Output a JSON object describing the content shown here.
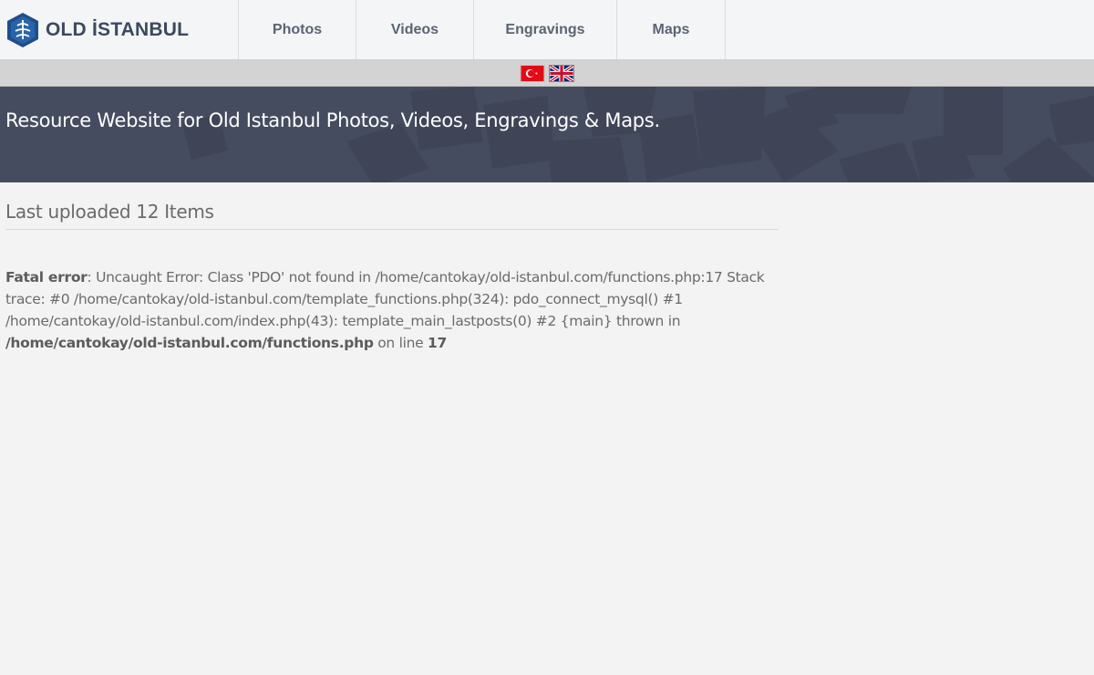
{
  "header": {
    "brand": "OLD İSTANBUL",
    "nav": [
      "Photos",
      "Videos",
      "Engravings",
      "Maps"
    ]
  },
  "languages": [
    "turkish-flag",
    "uk-flag"
  ],
  "hero": {
    "tagline": "Resource Website for Old Istanbul Photos, Videos, Engravings & Maps."
  },
  "main": {
    "section_title": "Last uploaded 12 Items",
    "error": {
      "label": "Fatal error",
      "message": ": Uncaught Error: Class 'PDO' not found in /home/cantokay/old-istanbul.com/functions.php:17 Stack trace: #0 /home/cantokay/old-istanbul.com/template_functions.php(324): pdo_connect_mysql() #1 /home/cantokay/old-istanbul.com/index.php(43): template_main_lastposts(0) #2 {main} thrown in ",
      "file": "/home/cantokay/old-istanbul.com/functions.php",
      "on_line": " on line ",
      "line": "17"
    }
  },
  "colors": {
    "hero_bg": "#464c5f",
    "brand_text": "#3b4a5e",
    "logo_blue": "#1f4e8c"
  }
}
